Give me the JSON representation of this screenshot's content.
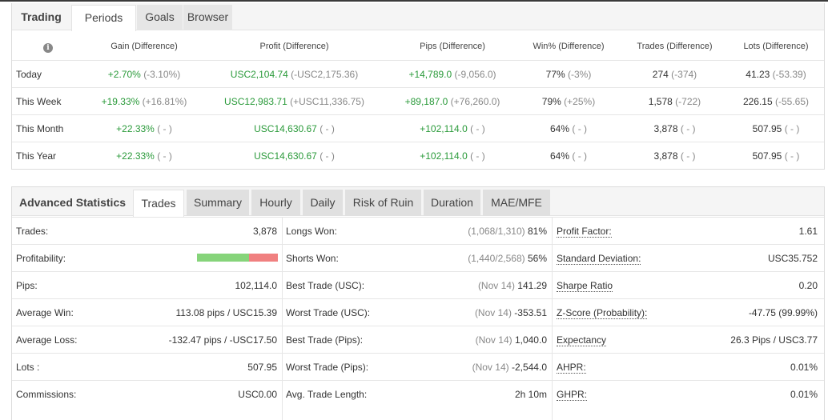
{
  "periods_panel": {
    "tabs": [
      {
        "label": "Trading",
        "kind": "title"
      },
      {
        "label": "Periods",
        "kind": "active"
      },
      {
        "label": "Goals",
        "kind": "tab"
      },
      {
        "label": "Browser",
        "kind": "tab"
      }
    ],
    "headers": [
      "Gain (Difference)",
      "Profit (Difference)",
      "Pips (Difference)",
      "Win% (Difference)",
      "Trades (Difference)",
      "Lots (Difference)"
    ],
    "info_icon": "info-icon",
    "rows": [
      {
        "label": "Today",
        "gain": "+2.70%",
        "gain_diff": "(-3.10%)",
        "profit": "USC2,104.74",
        "profit_diff": "(-USC2,175.36)",
        "pips": "+14,789.0",
        "pips_diff": "(-9,056.0)",
        "win": "77%",
        "win_diff": "(-3%)",
        "trades": "274",
        "trades_diff": "(-374)",
        "lots": "41.23",
        "lots_diff": "(-53.39)"
      },
      {
        "label": "This Week",
        "gain": "+19.33%",
        "gain_diff": "(+16.81%)",
        "profit": "USC12,983.71",
        "profit_diff": "(+USC11,336.75)",
        "pips": "+89,187.0",
        "pips_diff": "(+76,260.0)",
        "win": "79%",
        "win_diff": "(+25%)",
        "trades": "1,578",
        "trades_diff": "(-722)",
        "lots": "226.15",
        "lots_diff": "(-55.65)"
      },
      {
        "label": "This Month",
        "gain": "+22.33%",
        "gain_diff": "( - )",
        "profit": "USC14,630.67",
        "profit_diff": "( - )",
        "pips": "+102,114.0",
        "pips_diff": "( - )",
        "win": "64%",
        "win_diff": "( - )",
        "trades": "3,878",
        "trades_diff": "( - )",
        "lots": "507.95",
        "lots_diff": "( - )"
      },
      {
        "label": "This Year",
        "gain": "+22.33%",
        "gain_diff": "( - )",
        "profit": "USC14,630.67",
        "profit_diff": "( - )",
        "pips": "+102,114.0",
        "pips_diff": "( - )",
        "win": "64%",
        "win_diff": "( - )",
        "trades": "3,878",
        "trades_diff": "( - )",
        "lots": "507.95",
        "lots_diff": "( - )"
      }
    ]
  },
  "stats_panel": {
    "tabs": [
      {
        "label": "Advanced Statistics",
        "kind": "title"
      },
      {
        "label": "Trades",
        "kind": "active"
      },
      {
        "label": "Summary",
        "kind": "tab"
      },
      {
        "label": "Hourly",
        "kind": "tab"
      },
      {
        "label": "Daily",
        "kind": "tab"
      },
      {
        "label": "Risk of Ruin",
        "kind": "tab"
      },
      {
        "label": "Duration",
        "kind": "tab"
      },
      {
        "label": "MAE/MFE",
        "kind": "tab"
      }
    ],
    "col1": [
      {
        "label": "Trades:",
        "value": "3,878"
      },
      {
        "label": "Profitability:",
        "value": "",
        "bar": {
          "win_fraction": 0.64
        }
      },
      {
        "label": "Pips:",
        "value": "102,114.0"
      },
      {
        "label": "Average Win:",
        "value": "113.08 pips / USC15.39"
      },
      {
        "label": "Average Loss:",
        "value": "-132.47 pips / -USC17.50"
      },
      {
        "label": "Lots :",
        "value": "507.95"
      },
      {
        "label": "Commissions:",
        "value": "USC0.00"
      }
    ],
    "col2": [
      {
        "label": "Longs Won:",
        "note": "(1,068/1,310)",
        "value": "81%"
      },
      {
        "label": "Shorts Won:",
        "note": "(1,440/2,568)",
        "value": "56%"
      },
      {
        "label": "Best Trade (USC):",
        "note": "(Nov 14)",
        "value": "141.29"
      },
      {
        "label": "Worst Trade (USC):",
        "note": "(Nov 14)",
        "value": "-353.51"
      },
      {
        "label": "Best Trade (Pips):",
        "note": "(Nov 14)",
        "value": "1,040.0"
      },
      {
        "label": "Worst Trade (Pips):",
        "note": "(Nov 14)",
        "value": "-2,544.0"
      },
      {
        "label": "Avg. Trade Length:",
        "note": "",
        "value": "2h 10m"
      }
    ],
    "col3": [
      {
        "label": "Profit Factor:",
        "value": "1.61"
      },
      {
        "label": "Standard Deviation:",
        "value": "USC35.752"
      },
      {
        "label": "Sharpe Ratio",
        "value": "0.20"
      },
      {
        "label": "Z-Score (Probability):",
        "value": "-47.75 (99.99%)"
      },
      {
        "label": "Expectancy",
        "value": "26.3 Pips / USC3.77"
      },
      {
        "label": "AHPR:",
        "value": "0.01%"
      },
      {
        "label": "GHPR:",
        "value": "0.01%"
      }
    ]
  }
}
